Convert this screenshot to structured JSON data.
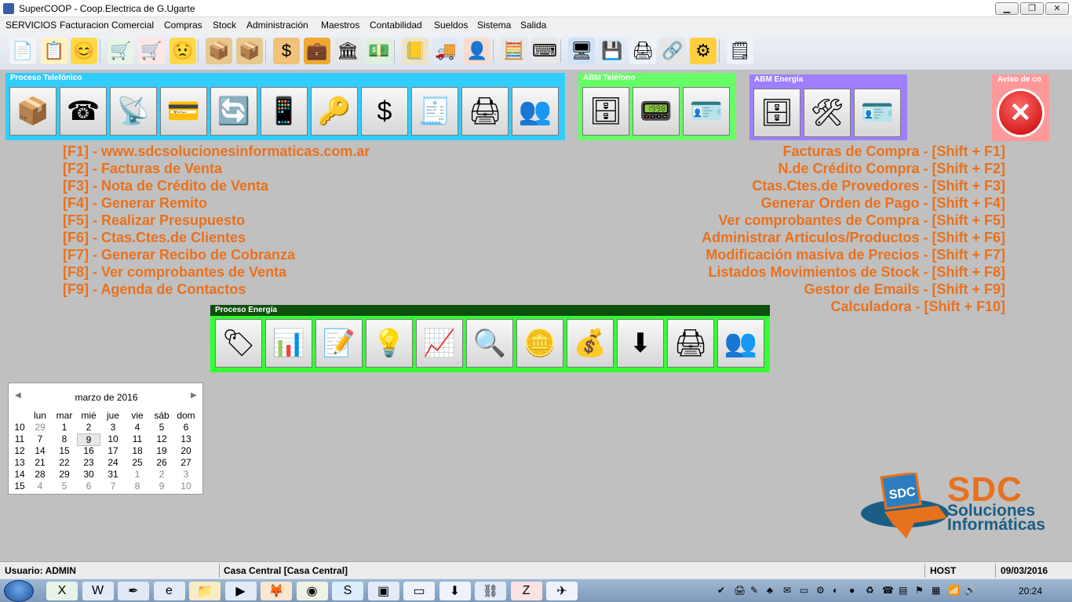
{
  "window": {
    "title": "SuperCOOP - Coop.Electrica de G.Ugarte",
    "buttons": [
      "▁",
      "❐",
      "✕"
    ]
  },
  "menu": [
    "SERVICIOS",
    "Facturacion Comercial",
    "Compras",
    "Stock",
    "Administración",
    "Maestros",
    "Contabilidad",
    "Sueldos",
    "Sistema",
    "Salida"
  ],
  "toolbar": [
    {
      "icon": "document-icon",
      "glyph": "📄"
    },
    {
      "icon": "clipboard-checklist-icon",
      "glyph": "📋"
    },
    {
      "icon": "smiley-happy-icon",
      "glyph": "😊"
    },
    {
      "icon": "cart-add-icon",
      "glyph": "🛒"
    },
    {
      "icon": "cart-remove-icon",
      "glyph": "🛒"
    },
    {
      "icon": "smiley-sad-icon",
      "glyph": "😟"
    },
    {
      "icon": "box-icon",
      "glyph": "📦"
    },
    {
      "icon": "boxes-stack-icon",
      "glyph": "📦"
    },
    {
      "icon": "dollar-icon",
      "glyph": "$"
    },
    {
      "icon": "briefcase-icon",
      "glyph": "💼"
    },
    {
      "icon": "bank-icon",
      "glyph": "🏛"
    },
    {
      "icon": "money-remove-icon",
      "glyph": "💵"
    },
    {
      "icon": "ledger-icon",
      "glyph": "📒"
    },
    {
      "icon": "delivery-truck-icon",
      "glyph": "🚚"
    },
    {
      "icon": "user-edit-icon",
      "glyph": "👤"
    },
    {
      "icon": "calculator-icon",
      "glyph": "🧮"
    },
    {
      "icon": "keyboard-add-icon",
      "glyph": "⌨"
    },
    {
      "icon": "monitor-network-icon",
      "glyph": "🖥"
    },
    {
      "icon": "backup-icon",
      "glyph": "💾"
    },
    {
      "icon": "printer-icon",
      "glyph": "🖨"
    },
    {
      "icon": "chain-link-icon",
      "glyph": "🔗"
    },
    {
      "icon": "settings-gear-icon",
      "glyph": "⚙"
    },
    {
      "icon": "form-icon",
      "glyph": "🗒"
    }
  ],
  "panels": {
    "telefono": {
      "title": "Proceso Telefónico",
      "color": "#33ccff",
      "buttons": [
        {
          "icon": "package-alert-icon",
          "glyph": "📦"
        },
        {
          "icon": "telephone-icon",
          "glyph": "☎"
        },
        {
          "icon": "satellite-computer-icon",
          "glyph": "📡"
        },
        {
          "icon": "card-dollar-icon",
          "glyph": "💳"
        },
        {
          "icon": "refresh-arrows-icon",
          "glyph": "🔄"
        },
        {
          "icon": "mobile-phone-icon",
          "glyph": "📱"
        },
        {
          "icon": "keys-icon",
          "glyph": "🔑"
        },
        {
          "icon": "dollar-sign-icon",
          "glyph": "$"
        },
        {
          "icon": "cash-register-icon",
          "glyph": "🧾"
        },
        {
          "icon": "printer-folder-icon",
          "glyph": "🖨"
        },
        {
          "icon": "users-upload-icon",
          "glyph": "👥"
        }
      ]
    },
    "abm_telefono": {
      "title": "ABM Teléfono",
      "color": "#66ff66",
      "buttons": [
        {
          "icon": "file-cabinet-icon",
          "glyph": "🗄"
        },
        {
          "icon": "pda-icon",
          "glyph": "📟"
        },
        {
          "icon": "contact-card-icon",
          "glyph": "🪪"
        }
      ]
    },
    "abm_energia": {
      "title": "ABM Energía",
      "color": "#9f7fff",
      "buttons": [
        {
          "icon": "file-cabinet-icon",
          "glyph": "🗄"
        },
        {
          "icon": "tools-window-icon",
          "glyph": "🛠"
        },
        {
          "icon": "contact-card-icon",
          "glyph": "🪪"
        }
      ]
    },
    "aviso": {
      "title": "Aviso de co",
      "color": "#ff9999",
      "icon": "close-icon",
      "glyph": "✕"
    },
    "energia": {
      "title": "Proceso Energía",
      "color": "#1a5c1a",
      "border": "#33ff33",
      "buttons": [
        {
          "icon": "price-tag-icon",
          "glyph": "🏷"
        },
        {
          "icon": "spreadsheet-icon",
          "glyph": "📊"
        },
        {
          "icon": "document-edit-icon",
          "glyph": "📝"
        },
        {
          "icon": "light-bulb-icon",
          "glyph": "💡"
        },
        {
          "icon": "chart-icon",
          "glyph": "📈"
        },
        {
          "icon": "folder-search-icon",
          "glyph": "🔍"
        },
        {
          "icon": "coins-icon",
          "glyph": "🪙"
        },
        {
          "icon": "money-documents-icon",
          "glyph": "💰"
        },
        {
          "icon": "download-arrow-icon",
          "glyph": "⬇"
        },
        {
          "icon": "printer-folder-icon",
          "glyph": "🖨"
        },
        {
          "icon": "users-upload-icon",
          "glyph": "👥"
        }
      ]
    }
  },
  "shortcuts_left": [
    "[F1] - www.sdcsolucionesinformaticas.com.ar",
    "[F2] - Facturas de Venta",
    "[F3] - Nota de Crédito de Venta",
    "[F4] - Generar Remito",
    "[F5] - Realizar Presupuesto",
    "[F6] - Ctas.Ctes.de Clientes",
    "[F7] - Generar Recibo de Cobranza",
    "[F8] - Ver comprobantes de Venta",
    "[F9] - Agenda de Contactos"
  ],
  "shortcuts_right": [
    "Facturas de Compra - [Shift + F1]",
    "N.de Crédito Compra - [Shift + F2]",
    "Ctas.Ctes.de Provedores - [Shift + F3]",
    "Generar Orden de Pago - [Shift + F4]",
    "Ver comprobantes de Compra - [Shift + F5]",
    "Administrar Articulos/Productos - [Shift + F6]",
    "Modificación masiva de Precios - [Shift + F7]",
    "Listados Movimientos de Stock - [Shift + F8]",
    "Gestor de Emails - [Shift + F9]",
    "Calculadora - [Shift + F10]"
  ],
  "shortcut_color": "#e8711e",
  "calendar": {
    "title": "marzo de 2016",
    "prev": "◀",
    "next": "▶",
    "days": [
      "lun",
      "mar",
      "mié",
      "jue",
      "vie",
      "sáb",
      "dom"
    ],
    "selected_day": "9",
    "weeks": [
      {
        "wk": "10",
        "days": [
          "29",
          "1",
          "2",
          "3",
          "4",
          "5",
          "6"
        ],
        "other": [
          true,
          false,
          false,
          false,
          false,
          false,
          false
        ]
      },
      {
        "wk": "11",
        "days": [
          "7",
          "8",
          "9",
          "10",
          "11",
          "12",
          "13"
        ],
        "other": [
          false,
          false,
          false,
          false,
          false,
          false,
          false
        ]
      },
      {
        "wk": "12",
        "days": [
          "14",
          "15",
          "16",
          "17",
          "18",
          "19",
          "20"
        ],
        "other": [
          false,
          false,
          false,
          false,
          false,
          false,
          false
        ]
      },
      {
        "wk": "13",
        "days": [
          "21",
          "22",
          "23",
          "24",
          "25",
          "26",
          "27"
        ],
        "other": [
          false,
          false,
          false,
          false,
          false,
          false,
          false
        ]
      },
      {
        "wk": "14",
        "days": [
          "28",
          "29",
          "30",
          "31",
          "1",
          "2",
          "3"
        ],
        "other": [
          false,
          false,
          false,
          false,
          true,
          true,
          true
        ]
      },
      {
        "wk": "15",
        "days": [
          "4",
          "5",
          "6",
          "7",
          "8",
          "9",
          "10"
        ],
        "other": [
          true,
          true,
          true,
          true,
          true,
          true,
          true
        ]
      }
    ]
  },
  "logo": {
    "badge": "SDC",
    "brand": "SDC",
    "line1": "Soluciones",
    "line2": "Informáticas"
  },
  "status": {
    "user": "Usuario: ADMIN",
    "branch": "Casa Central [Casa Central]",
    "host": "HOST",
    "date": "09/03/2016"
  },
  "taskbar": {
    "apps": [
      {
        "icon": "excel-icon",
        "glyph": "X"
      },
      {
        "icon": "word-icon",
        "glyph": "W"
      },
      {
        "icon": "feather-icon",
        "glyph": "✒"
      },
      {
        "icon": "internet-explorer-icon",
        "glyph": "e"
      },
      {
        "icon": "folder-icon",
        "glyph": "📁"
      },
      {
        "icon": "media-player-icon",
        "glyph": "▶"
      },
      {
        "icon": "firefox-icon",
        "glyph": "🦊"
      },
      {
        "icon": "chrome-icon",
        "glyph": "◉"
      },
      {
        "icon": "skype-icon",
        "glyph": "S"
      },
      {
        "icon": "virtualbox-icon",
        "glyph": "▣"
      },
      {
        "icon": "window-app-icon",
        "glyph": "▭"
      },
      {
        "icon": "pin-app-icon",
        "glyph": "⬇"
      },
      {
        "icon": "network-app-icon",
        "glyph": "⛓"
      },
      {
        "icon": "filezilla-icon",
        "glyph": "Z"
      },
      {
        "icon": "supercoop-app-icon",
        "glyph": "✈"
      }
    ],
    "tray": [
      "✔",
      "🖨",
      "✎",
      "♣",
      "✉",
      "▭",
      "⚙",
      "◐",
      "●",
      "♻",
      "☎",
      "▤",
      "⚑",
      "▦",
      "📶",
      "🔊"
    ],
    "clock": "20:24"
  }
}
